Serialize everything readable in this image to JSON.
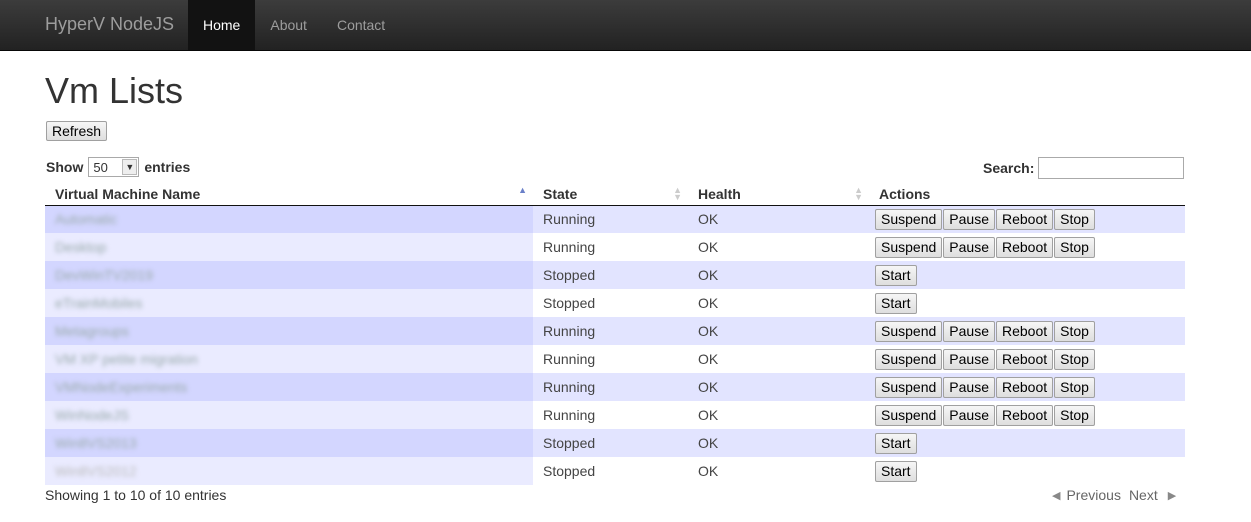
{
  "nav": {
    "brand": "HyperV NodeJS",
    "items": [
      {
        "label": "Home",
        "active": true
      },
      {
        "label": "About",
        "active": false
      },
      {
        "label": "Contact",
        "active": false
      }
    ]
  },
  "page": {
    "title": "Vm Lists",
    "refresh_label": "Refresh"
  },
  "length": {
    "prefix": "Show",
    "value": "50",
    "suffix": "entries"
  },
  "search": {
    "label": "Search:",
    "value": ""
  },
  "table": {
    "columns": [
      "Virtual Machine Name",
      "State",
      "Health",
      "Actions"
    ],
    "rows": [
      {
        "name": "Automatic",
        "state": "Running",
        "health": "OK",
        "actions": [
          "Suspend",
          "Pause",
          "Reboot",
          "Stop"
        ]
      },
      {
        "name": "Desktop",
        "state": "Running",
        "health": "OK",
        "actions": [
          "Suspend",
          "Pause",
          "Reboot",
          "Stop"
        ]
      },
      {
        "name": "DevWinTV2019",
        "state": "Stopped",
        "health": "OK",
        "actions": [
          "Start"
        ]
      },
      {
        "name": "eTrainMobiles",
        "state": "Stopped",
        "health": "OK",
        "actions": [
          "Start"
        ]
      },
      {
        "name": "Metagroups",
        "state": "Running",
        "health": "OK",
        "actions": [
          "Suspend",
          "Pause",
          "Reboot",
          "Stop"
        ]
      },
      {
        "name": "VM XP petite migration",
        "state": "Running",
        "health": "OK",
        "actions": [
          "Suspend",
          "Pause",
          "Reboot",
          "Stop"
        ]
      },
      {
        "name": "VMNodeExperiments",
        "state": "Running",
        "health": "OK",
        "actions": [
          "Suspend",
          "Pause",
          "Reboot",
          "Stop"
        ]
      },
      {
        "name": "WinNodeJS",
        "state": "Running",
        "health": "OK",
        "actions": [
          "Suspend",
          "Pause",
          "Reboot",
          "Stop"
        ]
      },
      {
        "name": "Win8VS2013",
        "state": "Stopped",
        "health": "OK",
        "actions": [
          "Start"
        ]
      },
      {
        "name": "Win8VS2012",
        "state": "Stopped",
        "health": "OK",
        "actions": [
          "Start"
        ]
      }
    ]
  },
  "footer": {
    "info": "Showing 1 to 10 of 10 entries",
    "previous": "Previous",
    "next": "Next"
  }
}
